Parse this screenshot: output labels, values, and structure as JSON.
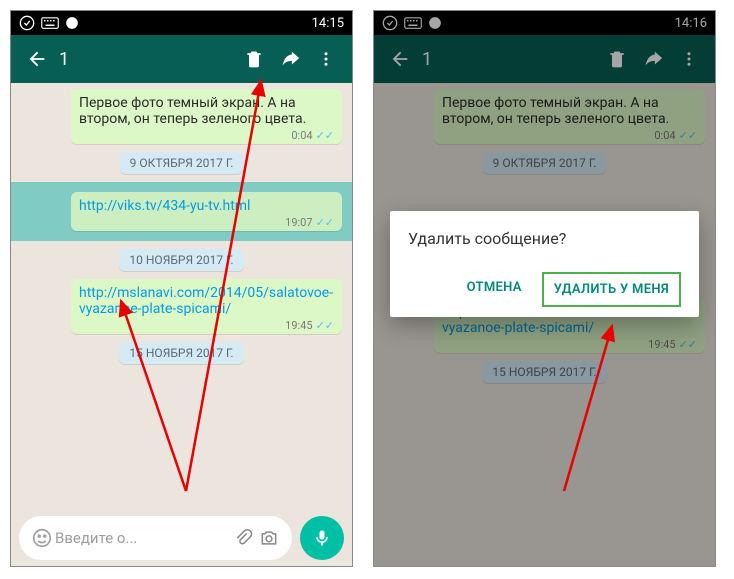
{
  "left": {
    "status_time": "14:15",
    "selected_count": "1",
    "msg1_text": "Первое фото темный экран. А на втором, он теперь зеленого цвета.",
    "msg1_time": "0:04",
    "date1": "9 ОКТЯБРЯ 2017 Г.",
    "msg2_link": "http://viks.tv/434-yu-tv.html",
    "msg2_time": "19:07",
    "date2": "10 НОЯБРЯ 2017 Г.",
    "msg3_link": "http://mslanavi.com/2014/05/salatovoe-vyazanoe-plate-spicami/",
    "msg3_time": "19:45",
    "date3": "15 НОЯБРЯ 2017 Г.",
    "input_placeholder": "Введите о..."
  },
  "right": {
    "status_time": "14:16",
    "selected_count": "1",
    "msg1_text": "Первое фото темный экран. А на втором, он теперь зеленого цвета.",
    "msg1_time": "0:04",
    "date1": "9 ОКТЯБРЯ 2017 Г.",
    "dialog_title": "Удалить сообщение?",
    "dialog_cancel": "ОТМЕНА",
    "dialog_delete": "УДАЛИТЬ У МЕНЯ",
    "msg3_link": "http://mslanavi.com/2014/05/salatovoe-vyazanoe-plate-spicami/",
    "msg3_time": "19:45",
    "date3": "15 НОЯБРЯ 2017 Г."
  }
}
